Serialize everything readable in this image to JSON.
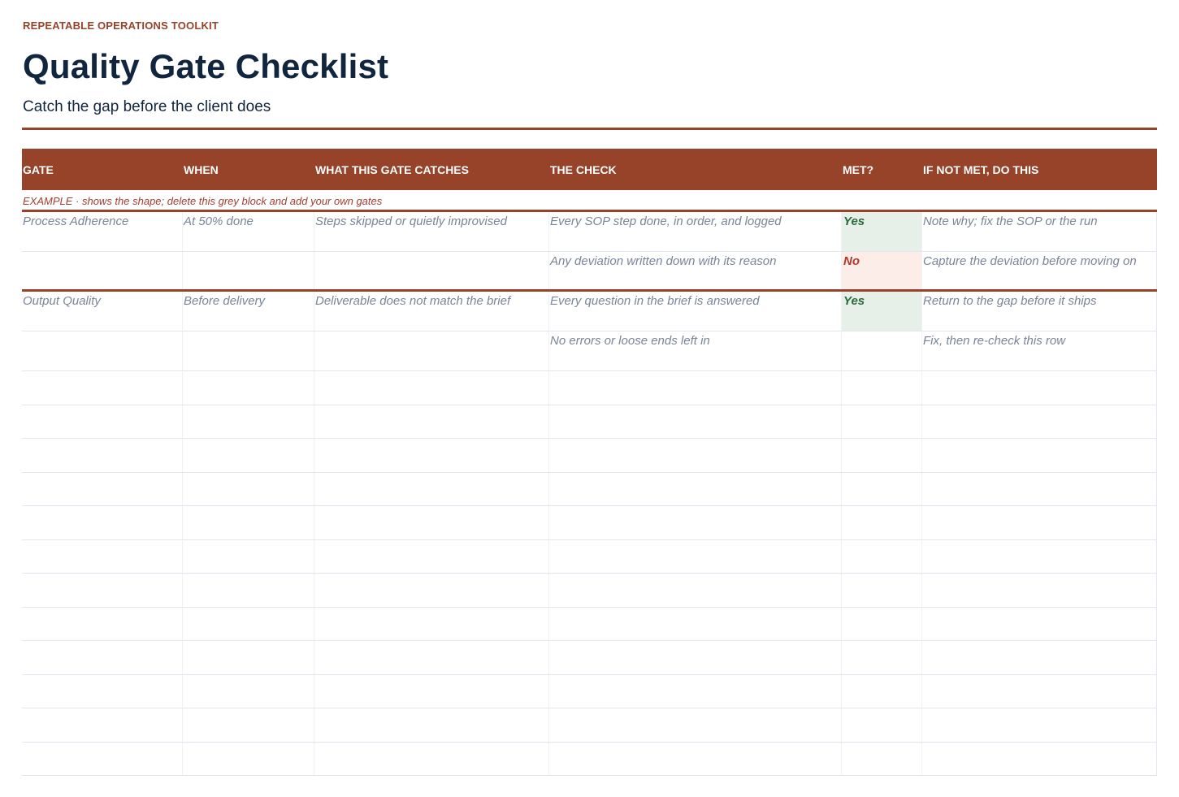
{
  "header": {
    "eyebrow": "REPEATABLE OPERATIONS TOOLKIT",
    "title": "Quality Gate Checklist",
    "subtitle": "Catch the gap before the client does"
  },
  "colors": {
    "accent": "#96432a",
    "title": "#12253f",
    "yes_bg": "#e6efe8",
    "yes_text": "#2b6a40",
    "no_bg": "#fcede9",
    "no_text": "#b0382b"
  },
  "table": {
    "columns": [
      "GATE",
      "WHEN",
      "WHAT THIS GATE CATCHES",
      "THE CHECK",
      "MET?",
      "IF NOT MET, DO THIS"
    ],
    "example_note": "EXAMPLE  ·  shows the shape; delete this grey block and add your own gates",
    "example_rows": [
      [
        "Process Adherence",
        "At 50% done",
        "Steps skipped or quietly improvised",
        "Every SOP step done, in order, and logged",
        "Yes",
        "Note why; fix the SOP or the run"
      ],
      [
        "",
        "",
        "",
        "Any deviation written down with its reason",
        "No",
        "Capture the deviation before moving on"
      ],
      [
        "Output Quality",
        "Before delivery",
        "Deliverable does not match the brief",
        "Every question in the brief is answered",
        "Yes",
        "Return to the gap before it ships"
      ],
      [
        "",
        "",
        "",
        "No errors or loose ends left in",
        "",
        "Fix, then re-check this row"
      ]
    ]
  }
}
